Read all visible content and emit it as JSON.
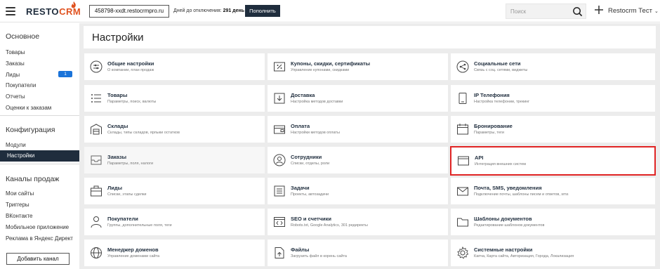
{
  "header": {
    "logo_text": "RESTOCRM",
    "account_id": "458798-xxdt.restocrmpro.ru",
    "days_label": "Дней до отключения:",
    "days_value": "291 день",
    "topup_label": "Пополнить",
    "search_placeholder": "Поиск",
    "user_name": "Restocrm Тест",
    "chevron": "⌄"
  },
  "sidebar": {
    "sections": [
      {
        "title": "Основное",
        "items": [
          "Товары",
          "Заказы",
          "Лиды",
          "Покупатели",
          "Отчеты",
          "Оценки к заказам"
        ]
      },
      {
        "title": "Конфигурация",
        "items": [
          "Модули",
          "Настройки"
        ]
      },
      {
        "title": "Каналы продаж",
        "items": [
          "Мои сайты",
          "Триггеры",
          "ВКонтакте",
          "Мобильное приложение",
          "Реклама в Яндекс Директ"
        ]
      }
    ],
    "leads_badge": "1",
    "active_item": "Настройки",
    "add_channel_label": "Добавить канал"
  },
  "main": {
    "page_title": "Настройки",
    "cards": [
      {
        "title": "Общие настройки",
        "desc": "О компании, план продаж",
        "icon": "sliders-icon"
      },
      {
        "title": "Купоны, скидки, сертификаты",
        "desc": "Управление купонами, скидками",
        "icon": "percent-tag-icon"
      },
      {
        "title": "Социальные сети",
        "desc": "Связь с соц. сетями, виджеты",
        "icon": "share-icon"
      },
      {
        "title": "Товары",
        "desc": "Параметры, поиск, валюты",
        "icon": "list-icon"
      },
      {
        "title": "Доставка",
        "desc": "Настройка методов доставки",
        "icon": "delivery-box-icon"
      },
      {
        "title": "IP Телефония",
        "desc": "Настройка телефонии, трекинг",
        "icon": "phone-icon"
      },
      {
        "title": "Склады",
        "desc": "Склады, типы складов, ярлыки остатков",
        "icon": "warehouse-icon"
      },
      {
        "title": "Оплата",
        "desc": "Настройки методов оплаты",
        "icon": "wallet-icon"
      },
      {
        "title": "Бронирование",
        "desc": "Параметры, теги",
        "icon": "calendar-icon"
      },
      {
        "title": "Заказы",
        "desc": "Параметры, поля, налоги",
        "icon": "tray-icon"
      },
      {
        "title": "Сотрудники",
        "desc": "Списки, отделы, роли",
        "icon": "user-circle-icon"
      },
      {
        "title": "API",
        "desc": "Интеграция внешних систем",
        "icon": "api-window-icon"
      },
      {
        "title": "Лиды",
        "desc": "Списки, этапы сделки",
        "icon": "briefcase-icon"
      },
      {
        "title": "Задачи",
        "desc": "Проекты, автозадачи",
        "icon": "task-list-icon"
      },
      {
        "title": "Почта, SMS, уведомления",
        "desc": "Подключение почты, шаблоны писем и ответов, sms",
        "icon": "envelope-icon"
      },
      {
        "title": "Покупатели",
        "desc": "Группы, дополнительные поля, теги",
        "icon": "person-icon"
      },
      {
        "title": "SEO и счетчики",
        "desc": "Robots.txt, Google Analytics, 301 редиректы",
        "icon": "code-window-icon"
      },
      {
        "title": "Шаблоны документов",
        "desc": "Редактирование шаблонов документов",
        "icon": "folder-icon"
      },
      {
        "title": "Менеджер доменов",
        "desc": "Управление доменами сайта",
        "icon": "globe-icon"
      },
      {
        "title": "Файлы",
        "desc": "Загрузить файл в корень сайта",
        "icon": "file-upload-icon"
      },
      {
        "title": "Системные настройки",
        "desc": "Капча, Карта сайта, Авторизация, Города, Локализация",
        "icon": "gear-icon"
      }
    ],
    "highlighted_card": "API"
  },
  "colors": {
    "brand_dark": "#1f2d3d",
    "brand_accent": "#e0521f",
    "badge_blue": "#1a73d9",
    "highlight_red": "#e02424"
  }
}
